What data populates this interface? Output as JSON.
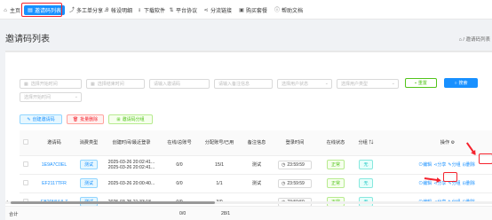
{
  "nav": {
    "items": [
      {
        "label": "主页",
        "icon": "home-icon",
        "glyph": "⌂"
      },
      {
        "label": "邀请码列表",
        "icon": "list-icon",
        "glyph": "▤"
      },
      {
        "label": "多工单分享",
        "icon": "share-icon",
        "glyph": "⤴"
      },
      {
        "label": "帐设明细",
        "icon": "detail-icon",
        "glyph": "Ꭿ"
      },
      {
        "label": "下载软件",
        "icon": "download-icon",
        "glyph": "⭳"
      },
      {
        "label": "平台协议",
        "icon": "protocol-icon",
        "glyph": "⇅"
      },
      {
        "label": "分流链接",
        "icon": "link-icon",
        "glyph": "⋖"
      },
      {
        "label": "购买套餐",
        "icon": "cart-icon",
        "glyph": "▣"
      },
      {
        "label": "帮助文档",
        "icon": "help-icon",
        "glyph": "ⓘ"
      }
    ]
  },
  "page": {
    "title": "邀请码列表",
    "breadcrumb_home": "⌂",
    "breadcrumb_sep": "/",
    "breadcrumb_current": "邀请码列表"
  },
  "filters": {
    "row1": [
      "选择开始时间",
      "选择结束时间",
      "请输入邀请码",
      "请输入备注信息",
      "选择用户状态",
      "选择用户类型"
    ],
    "row2": [
      "选择开始时间"
    ],
    "reset": "重置",
    "search": "搜索"
  },
  "actions": {
    "create": "创建邀请码",
    "delete": "批量删除",
    "generate": "邀请码分组"
  },
  "table": {
    "headers": [
      "邀请码",
      "消费类型",
      "创建时间/最近登录",
      "在线/总账号",
      "分配账号/已用",
      "备注信息",
      "登录时间",
      "在线状态",
      "分组",
      "",
      "操作"
    ],
    "ops_header_icon": "⚙",
    "rows": [
      {
        "code": "1E9A7C0EL",
        "type": "测试",
        "time1": "2025-03-26 20:02:41...",
        "time2": "2025-03-26 20:02:41...",
        "online": "0/0",
        "alloc": "15/1",
        "note": "测试",
        "login": "23:59:59",
        "status": "正常",
        "group": "无",
        "ops": [
          "编辑",
          "分享",
          "分组",
          "删除"
        ]
      },
      {
        "code": "EF2117TFR",
        "type": "测试",
        "time1": "2025-03-26 20:00:40...",
        "time2": "",
        "online": "0/0",
        "alloc": "1/1",
        "note": "测试",
        "login": "23:59:59",
        "status": "正常",
        "group": "无",
        "ops": [
          "编辑",
          "分享",
          "分组",
          "删除"
        ]
      },
      {
        "code": "EB20MVULZ",
        "type": "测试",
        "time1": "2025-03-25 21:33:18...",
        "time2": "",
        "online": "0/0",
        "alloc": "3/0",
        "note": "",
        "login": "23:59:59",
        "status": "正常",
        "group": "无",
        "ops": [
          "编辑",
          "分享",
          "分组",
          "删除"
        ]
      }
    ]
  },
  "summary": {
    "label": "合计",
    "online": "0/0",
    "alloc": "28/1"
  },
  "colors": {
    "primary": "#1890ff",
    "danger": "#f5222d",
    "success": "#52c41a"
  }
}
